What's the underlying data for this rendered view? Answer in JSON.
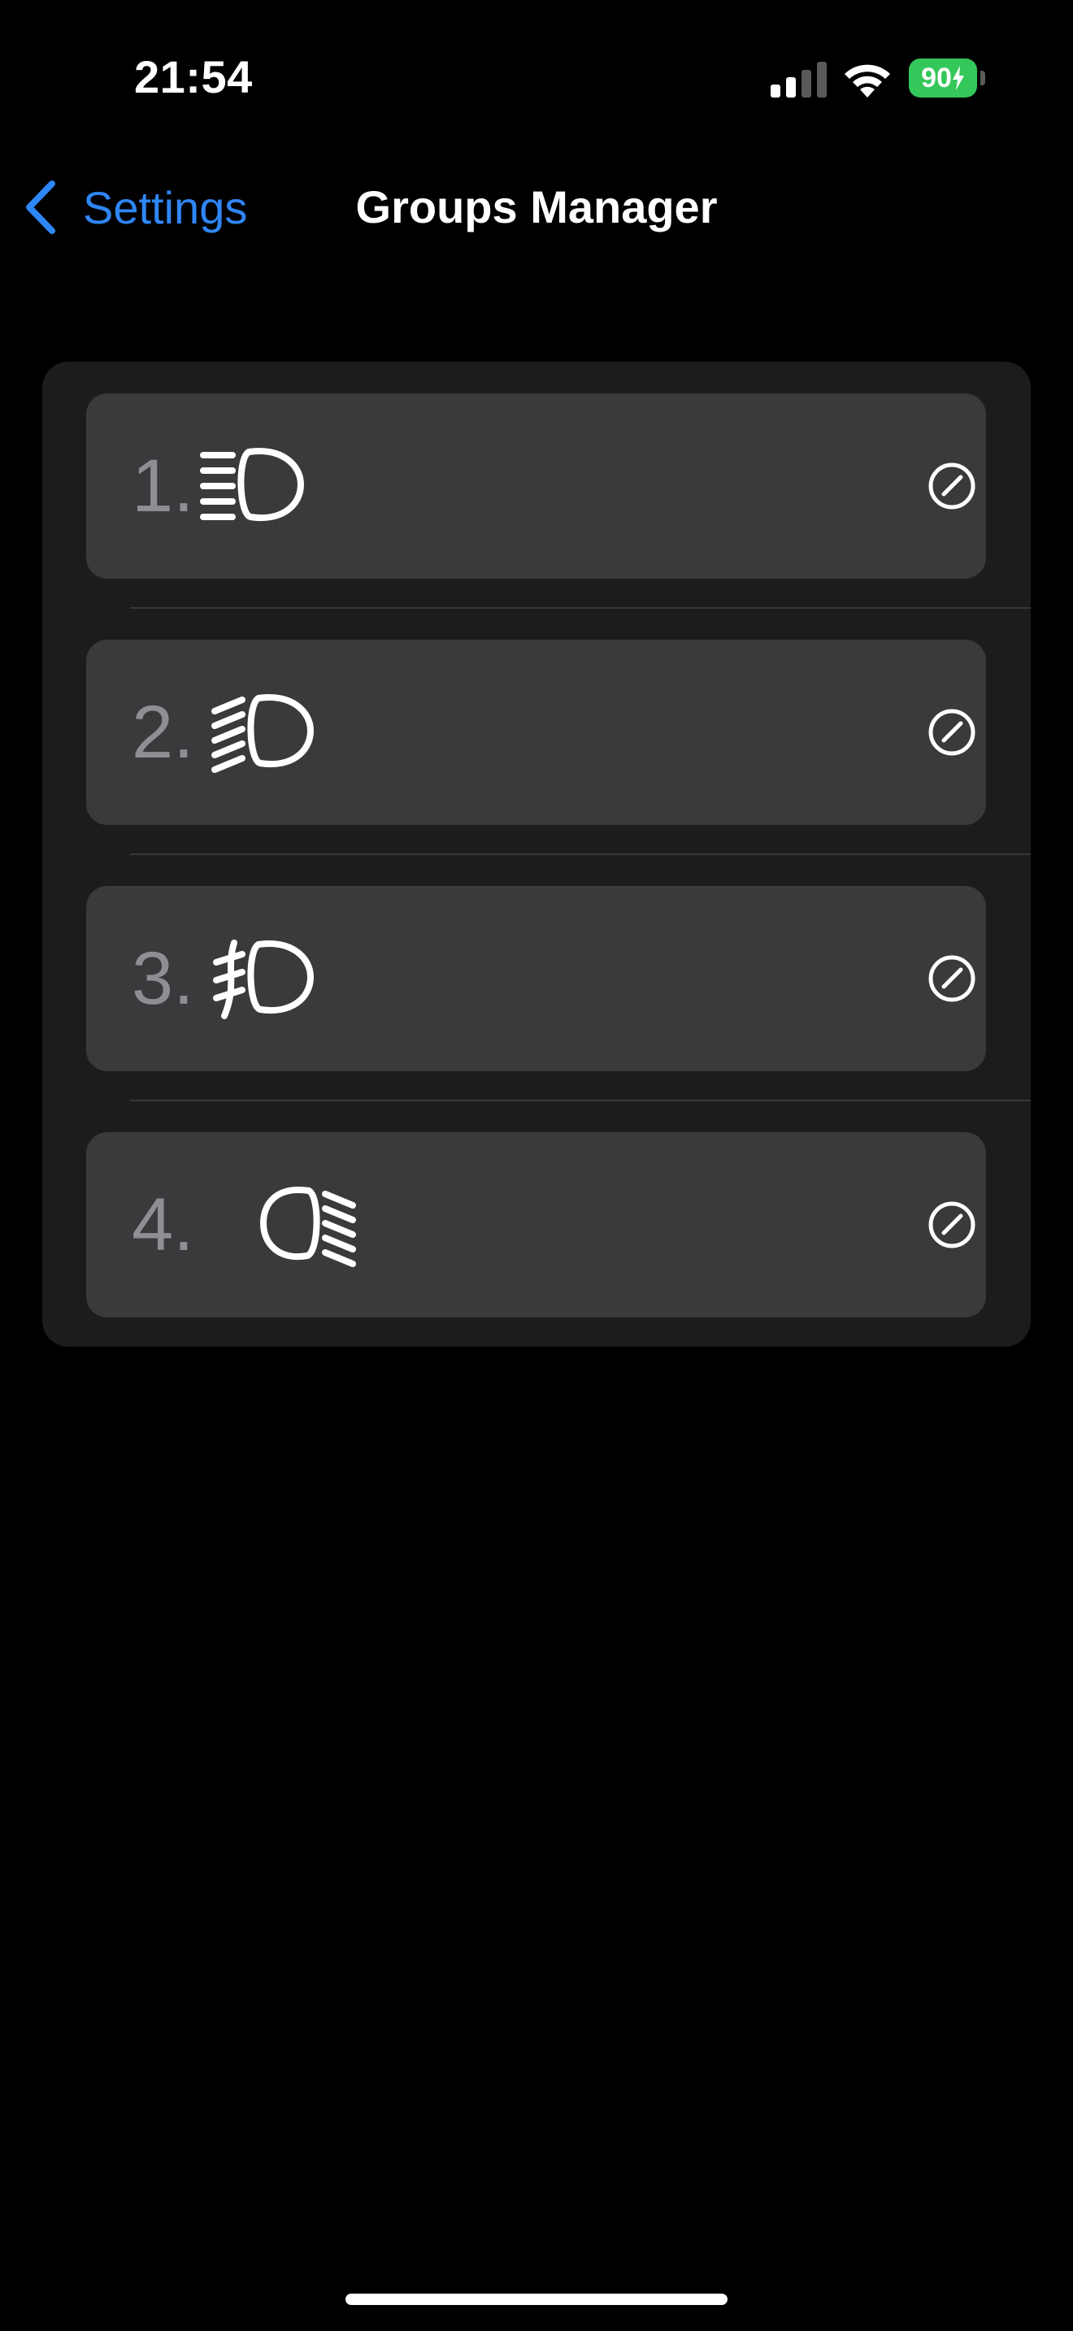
{
  "status_bar": {
    "time": "21:54",
    "battery_level": "90",
    "battery_charging": true,
    "signal_bars_active": 2,
    "signal_bars_total": 4
  },
  "nav": {
    "back_label": "Settings",
    "title": "Groups Manager"
  },
  "groups": [
    {
      "number": "1.",
      "icon": "high-beam-icon"
    },
    {
      "number": "2.",
      "icon": "low-beam-icon"
    },
    {
      "number": "3.",
      "icon": "front-fog-light-icon"
    },
    {
      "number": "4.",
      "icon": "rear-fog-light-icon"
    }
  ],
  "colors": {
    "background": "#000000",
    "accent": "#2f86f6",
    "list_background": "#1c1c1e",
    "row_background": "#3a3a3c",
    "number_text": "#8e8e93",
    "battery": "#34c759"
  }
}
